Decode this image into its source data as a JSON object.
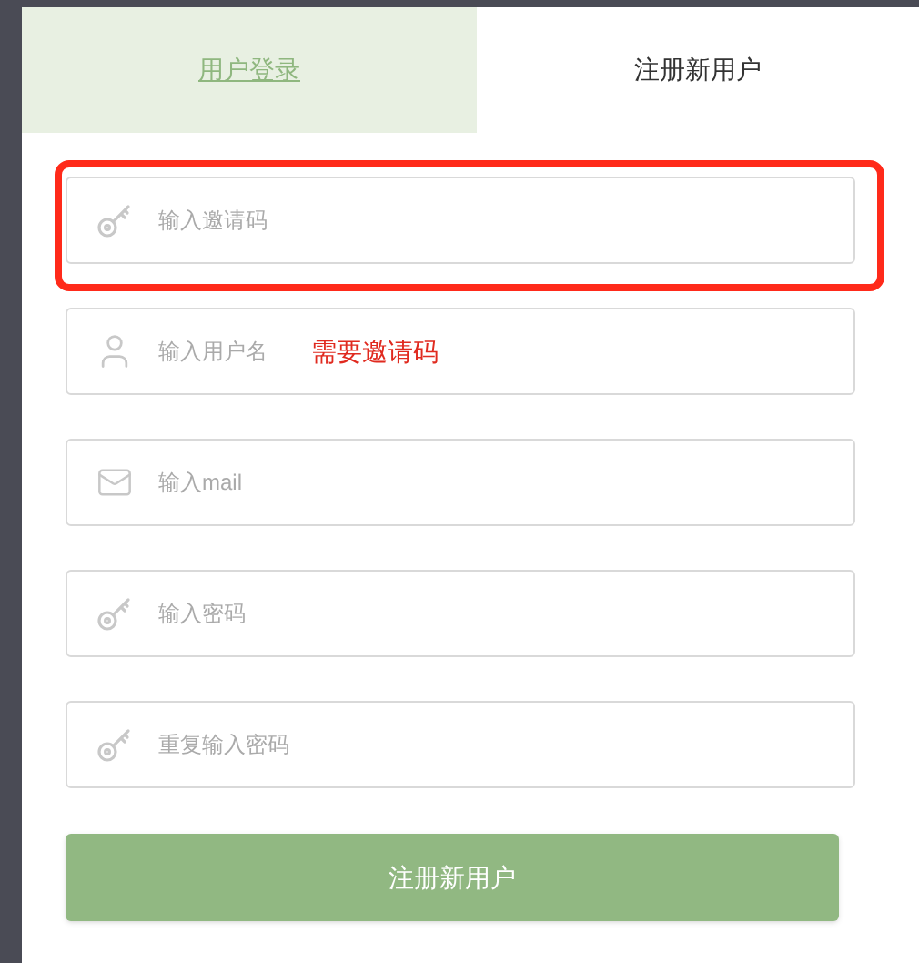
{
  "tabs": [
    {
      "label": "用户登录",
      "selected": false
    },
    {
      "label": "注册新用户",
      "selected": true
    }
  ],
  "fields": [
    {
      "kind": "key",
      "placeholder": "输入邀请码",
      "highlighted": true
    },
    {
      "kind": "user",
      "placeholder": "输入用户名",
      "note": "需要邀请码",
      "highlighted": false
    },
    {
      "kind": "mail",
      "placeholder": "输入mail",
      "highlighted": false
    },
    {
      "kind": "key",
      "placeholder": "输入密码",
      "highlighted": false
    },
    {
      "kind": "key",
      "placeholder": "重复输入密码",
      "highlighted": false
    }
  ],
  "submit_button": "注册新用户"
}
